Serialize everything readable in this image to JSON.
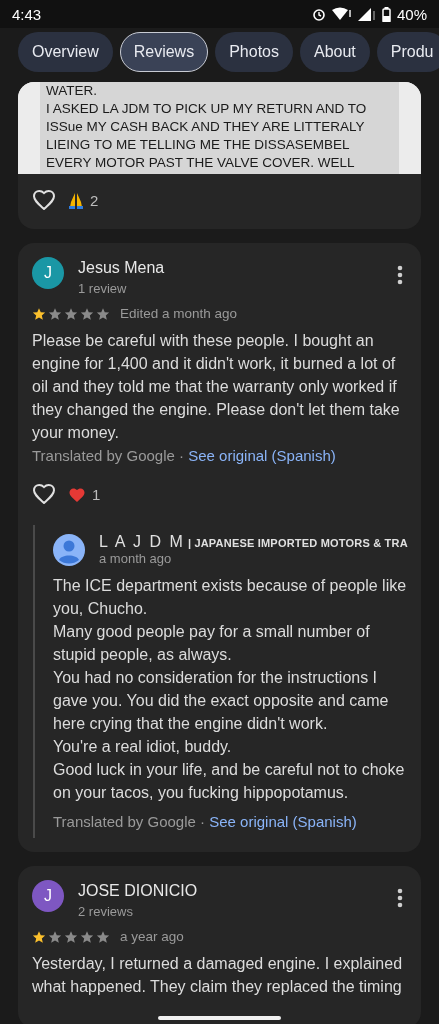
{
  "status_bar": {
    "time": "4:43",
    "battery": "40%"
  },
  "tabs": [
    {
      "label": "Overview",
      "selected": false
    },
    {
      "label": "Reviews",
      "selected": true
    },
    {
      "label": "Photos",
      "selected": false
    },
    {
      "label": "About",
      "selected": false
    },
    {
      "label": "Produ",
      "selected": false
    }
  ],
  "reviews": [
    {
      "kind": "photo",
      "photo_lines": [
        "WATER.",
        "I ASKED LA JDM TO PICK UP MY RETURN AND TO",
        "ISSue MY CASH BACK AND THEY ARE LITTERALY",
        "LIEING TO ME TELLING ME THE DISSASEMBEL",
        "EVERY MOTOR PAST THE VALVE COVER. WELL"
      ],
      "reaction": {
        "kind": "pray",
        "count": "2"
      }
    },
    {
      "kind": "full",
      "author": "Jesus Mena",
      "initial": "J",
      "color": "#1a97a5",
      "meta": "1 review",
      "stars": 1,
      "date": "Edited a month ago",
      "body": "Please be careful with these people. I bought an engine for 1,400 and it didn't work, it burned a lot of oil and they told me that the warranty only worked if they changed the engine. Please don't let them take your money.",
      "translated": "Translated by Google",
      "separator": "·",
      "link": "See original (Spanish)",
      "reaction": {
        "kind": "heart",
        "count": "1"
      },
      "owner_reply": {
        "name": "L A J D M",
        "tagline": "| JAPANESE IMPORTED MOTORS & TRA",
        "date": "a month ago",
        "lines": [
          "The ICE department exists because of people like you, Chucho.",
          "Many good people pay for a small number of stupid people, as always.",
          "You had no consideration for the instructions I gave you. You did the exact opposite and came here crying that the engine didn't work.",
          "You're a real idiot, buddy.",
          "Good luck in your life, and be careful not to choke on your tacos, you fucking hippopotamus."
        ],
        "translated": "Translated by Google",
        "separator": "·",
        "link": "See original (Spanish)"
      }
    },
    {
      "kind": "full",
      "author": "JOSE DIONICIO",
      "initial": "J",
      "color": "#7e57c2",
      "meta": "2 reviews",
      "stars": 1,
      "date": "a year ago",
      "body": "Yesterday, I returned a damaged engine. I explained what happened. They claim they replaced the timing"
    }
  ]
}
